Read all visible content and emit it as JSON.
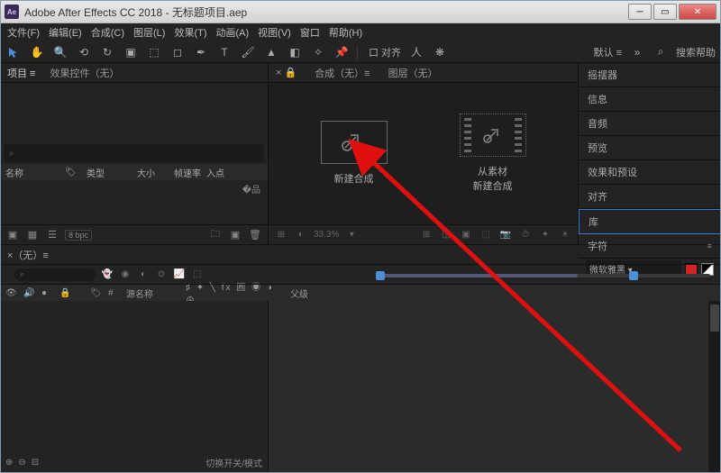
{
  "window": {
    "app_icon_text": "Ae",
    "title": "Adobe After Effects CC 2018 - 无标题项目.aep"
  },
  "menu": {
    "items": [
      "文件(F)",
      "编辑(E)",
      "合成(C)",
      "图层(L)",
      "效果(T)",
      "动画(A)",
      "视图(V)",
      "窗口",
      "帮助(H)"
    ]
  },
  "toolbar": {
    "snap_label": "口 对齐",
    "default_label": "默认 ≡",
    "search_help": "搜索帮助"
  },
  "project": {
    "tab_project": "项目 ≡",
    "tab_effectctrl": "效果控件（无）",
    "search_placeholder": "⌕",
    "col_name": "名称",
    "col_type": "类型",
    "col_size": "大小",
    "col_fps": "帧速率",
    "col_in": "入点",
    "bpc": "8 bpc"
  },
  "comp": {
    "tab_lock": "×",
    "tab_comp": "合成（无）≡",
    "tab_layer": "图层（无）",
    "card_new": "新建合成",
    "card_fromfootage": "从素材\n新建合成",
    "zoom": "33.3%"
  },
  "right": {
    "wiggler": "摇摆器",
    "info": "信息",
    "audio": "音频",
    "preview": "预览",
    "effects_presets": "效果和预设",
    "align": "对齐",
    "library": "库",
    "character": "字符",
    "font_name": "微软雅黑"
  },
  "timeline": {
    "tab_none": "×（无）≡",
    "time": "",
    "search_placeholder": "⌕",
    "col_source": "源名称",
    "col_switches": "♯ ✦ ╲ fx 圓 ◉ ◑ ⊕",
    "col_parent": "父级",
    "switches_label": "切换开关/模式"
  }
}
